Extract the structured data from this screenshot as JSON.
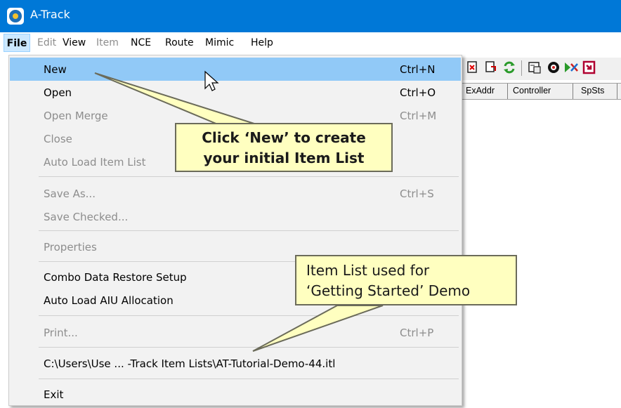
{
  "window": {
    "title": "A-Track"
  },
  "menubar": {
    "items": [
      "File",
      "Edit",
      "View",
      "Item",
      "NCE",
      "Route",
      "Mimic",
      "Help"
    ],
    "disabled": [
      false,
      true,
      false,
      true,
      false,
      false,
      false,
      false
    ]
  },
  "columns": {
    "headers": [
      "ExAddr",
      "Controller",
      "SpSts"
    ]
  },
  "toolbar": {
    "icons": [
      "delete-item-icon",
      "copy-item-icon",
      "refresh-icon",
      "properties-icon",
      "target-icon",
      "route-icon",
      "exit-door-icon"
    ]
  },
  "file_menu": {
    "items": [
      {
        "label": "New",
        "shortcut": "Ctrl+N",
        "enabled": true,
        "highlighted": true
      },
      {
        "label": "Open",
        "shortcut": "Ctrl+O",
        "enabled": true
      },
      {
        "label": "Open Merge",
        "shortcut": "Ctrl+M",
        "enabled": false
      },
      {
        "label": "Close",
        "shortcut": "",
        "enabled": false
      },
      {
        "label": "Auto Load Item List",
        "shortcut": "",
        "enabled": false
      },
      {
        "label": "Save As...",
        "shortcut": "Ctrl+S",
        "enabled": false
      },
      {
        "label": "Save Checked...",
        "shortcut": "",
        "enabled": false
      },
      {
        "label": "Properties",
        "shortcut": "",
        "enabled": false
      },
      {
        "label": "Combo Data Restore Setup",
        "shortcut": "",
        "enabled": true
      },
      {
        "label": "Auto Load AIU Allocation",
        "shortcut": "",
        "enabled": true
      },
      {
        "label": "Print...",
        "shortcut": "Ctrl+P",
        "enabled": false
      },
      {
        "label": "C:\\Users\\Use ... -Track Item Lists\\AT-Tutorial-Demo-44.itl",
        "shortcut": "",
        "enabled": true
      },
      {
        "label": "Exit",
        "shortcut": "",
        "enabled": true
      }
    ]
  },
  "callouts": {
    "new_hint": {
      "line1": "Click ‘New’ to create",
      "line2": "your initial Item List"
    },
    "demo_hint": {
      "line1": "Item List used for",
      "line2": "‘Getting Started’ Demo"
    }
  },
  "colors": {
    "titlebar": "#0078d7",
    "highlight": "#91c9f7",
    "callout_fill": "#ffffc0"
  }
}
